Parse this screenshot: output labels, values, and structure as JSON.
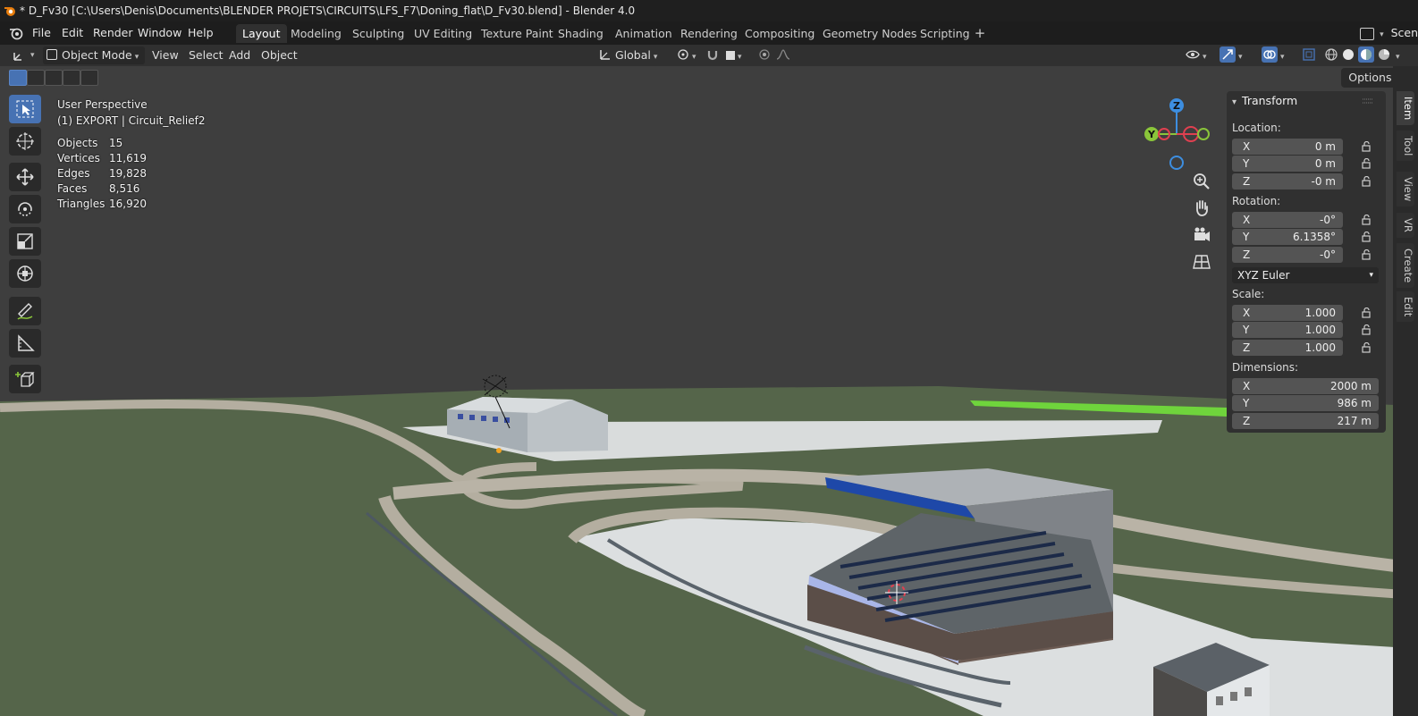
{
  "window": {
    "title": "* D_Fv30 [C:\\Users\\Denis\\Documents\\BLENDER PROJETS\\CIRCUITS\\LFS_F7\\Doning_flat\\D_Fv30.blend] - Blender 4.0"
  },
  "menu": [
    "File",
    "Edit",
    "Render",
    "Window",
    "Help"
  ],
  "workspaces": [
    "Layout",
    "Modeling",
    "Sculpting",
    "UV Editing",
    "Texture Paint",
    "Shading",
    "Animation",
    "Rendering",
    "Compositing",
    "Geometry Nodes",
    "Scripting"
  ],
  "active_workspace": "Layout",
  "scene_label": "Scen",
  "header": {
    "mode": "Object Mode",
    "menus": [
      "View",
      "Select",
      "Add",
      "Object"
    ],
    "orientation": "Global"
  },
  "viewport": {
    "options_label": "Options",
    "view_name": "User Perspective",
    "active_object": "(1) EXPORT | Circuit_Relief2",
    "stats": [
      {
        "label": "Objects",
        "value": "15"
      },
      {
        "label": "Vertices",
        "value": "11,619"
      },
      {
        "label": "Edges",
        "value": "19,828"
      },
      {
        "label": "Faces",
        "value": "8,516"
      },
      {
        "label": "Triangles",
        "value": "16,920"
      }
    ],
    "gizmo_axes": [
      "Z",
      "Y"
    ]
  },
  "tools": [
    "select-box",
    "cursor",
    "move",
    "rotate",
    "scale",
    "transform",
    "annotate",
    "measure",
    "add-cube"
  ],
  "transform": {
    "title": "Transform",
    "location_label": "Location:",
    "location": [
      {
        "axis": "X",
        "value": "0 m"
      },
      {
        "axis": "Y",
        "value": "0 m"
      },
      {
        "axis": "Z",
        "value": "-0 m"
      }
    ],
    "rotation_label": "Rotation:",
    "rotation": [
      {
        "axis": "X",
        "value": "-0°"
      },
      {
        "axis": "Y",
        "value": "6.1358°"
      },
      {
        "axis": "Z",
        "value": "-0°"
      }
    ],
    "rotation_mode": "XYZ Euler",
    "scale_label": "Scale:",
    "scale": [
      {
        "axis": "X",
        "value": "1.000"
      },
      {
        "axis": "Y",
        "value": "1.000"
      },
      {
        "axis": "Z",
        "value": "1.000"
      }
    ],
    "dimensions_label": "Dimensions:",
    "dimensions": [
      {
        "axis": "X",
        "value": "2000 m"
      },
      {
        "axis": "Y",
        "value": "986 m"
      },
      {
        "axis": "Z",
        "value": "217 m"
      }
    ]
  },
  "sidebar_tabs": [
    "Item",
    "Tool",
    "View",
    "VR",
    "Create",
    "Edit"
  ],
  "colors": {
    "accent": "#4772b3",
    "x_axis": "#e04050",
    "y_axis": "#8ac53a",
    "z_axis": "#3d8ee0"
  }
}
